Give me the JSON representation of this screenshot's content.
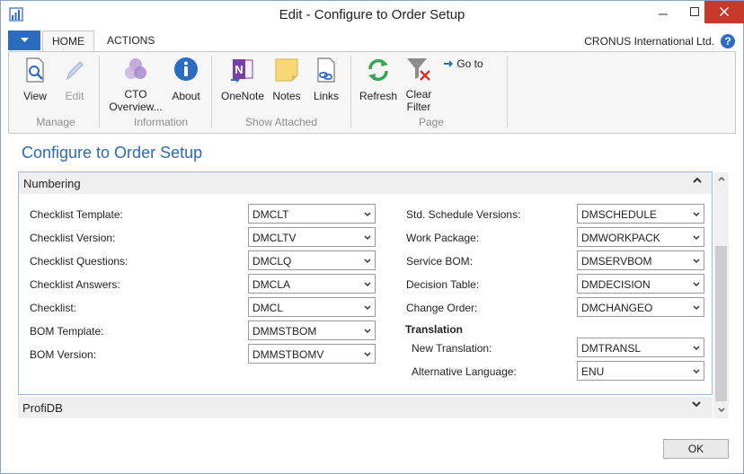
{
  "window": {
    "title": "Edit - Configure to Order Setup"
  },
  "ribbon": {
    "tabs": [
      {
        "label": "HOME"
      },
      {
        "label": "ACTIONS"
      }
    ],
    "company": "CRONUS International Ltd.",
    "help": "?",
    "groups": {
      "manage": {
        "label": "Manage",
        "view": "View",
        "edit": "Edit"
      },
      "information": {
        "label": "Information",
        "cto_overview_1": "CTO",
        "cto_overview_2": "Overview...",
        "about": "About"
      },
      "show_attached": {
        "label": "Show Attached",
        "onenote": "OneNote",
        "notes": "Notes",
        "links": "Links"
      },
      "page": {
        "label": "Page",
        "refresh": "Refresh",
        "clear_filter_1": "Clear",
        "clear_filter_2": "Filter",
        "goto": "Go to"
      }
    }
  },
  "page": {
    "title": "Configure to Order Setup"
  },
  "numbering": {
    "title": "Numbering",
    "left": [
      {
        "label": "Checklist Template:",
        "value": "DMCLT"
      },
      {
        "label": "Checklist Version:",
        "value": "DMCLTV"
      },
      {
        "label": "Checklist Questions:",
        "value": "DMCLQ"
      },
      {
        "label": "Checklist Answers:",
        "value": "DMCLA"
      },
      {
        "label": "Checklist:",
        "value": "DMCL"
      },
      {
        "label": "BOM Template:",
        "value": "DMMSTBOM"
      },
      {
        "label": "BOM Version:",
        "value": "DMMSTBOMV"
      }
    ],
    "right": [
      {
        "label": "Std. Schedule Versions:",
        "value": "DMSCHEDULE"
      },
      {
        "label": "Work Package:",
        "value": "DMWORKPACK"
      },
      {
        "label": "Service BOM:",
        "value": "DMSERVBOM"
      },
      {
        "label": "Decision Table:",
        "value": "DMDECISION"
      },
      {
        "label": "Change Order:",
        "value": "DMCHANGEO"
      }
    ],
    "translation": {
      "heading": "Translation",
      "fields": [
        {
          "label": "New Translation:",
          "value": "DMTRANSL"
        },
        {
          "label": "Alternative Language:",
          "value": "ENU"
        }
      ]
    }
  },
  "profidb": {
    "title": "ProfiDB"
  },
  "footer": {
    "ok": "OK"
  },
  "colors": {
    "accent": "#2d6ab4",
    "file_button": "#2a6cc2",
    "close_button": "#c7392b",
    "fasttab_border": "#9ab9e0"
  }
}
